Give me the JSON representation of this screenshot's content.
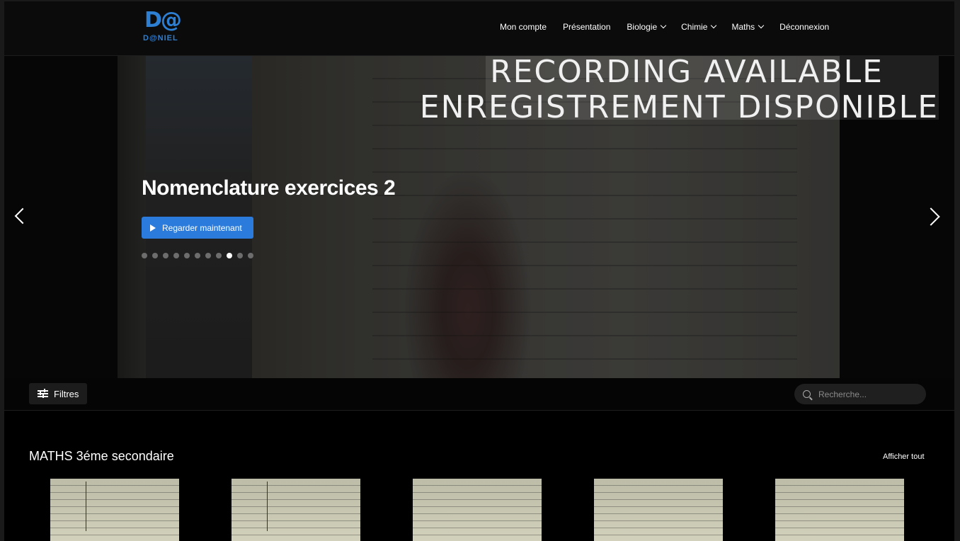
{
  "logo": {
    "mark": "D@",
    "word": "D@NIEL"
  },
  "nav": {
    "items": [
      {
        "label": "Mon compte",
        "dropdown": false
      },
      {
        "label": "Présentation",
        "dropdown": false
      },
      {
        "label": "Biologie",
        "dropdown": true
      },
      {
        "label": "Chimie",
        "dropdown": true
      },
      {
        "label": "Maths",
        "dropdown": true
      },
      {
        "label": "Déconnexion",
        "dropdown": false
      }
    ]
  },
  "hero": {
    "overlay_line1": "RECORDING  AVAILABLE",
    "overlay_line2": "ENREGISTREMENT DISPONIBLE",
    "title": "Nomenclature exercices 2",
    "watch_label": "Regarder maintenant",
    "slide_count": 11,
    "active_slide": 9
  },
  "filters": {
    "label": "Filtres"
  },
  "search": {
    "placeholder": "Recherche..."
  },
  "section": {
    "title": "MATHS 3éme secondaire",
    "see_all": "Afficher tout",
    "cards": 5
  },
  "colors": {
    "accent": "#2a7bdb",
    "logo": "#2d7fd3",
    "background": "#000000"
  }
}
